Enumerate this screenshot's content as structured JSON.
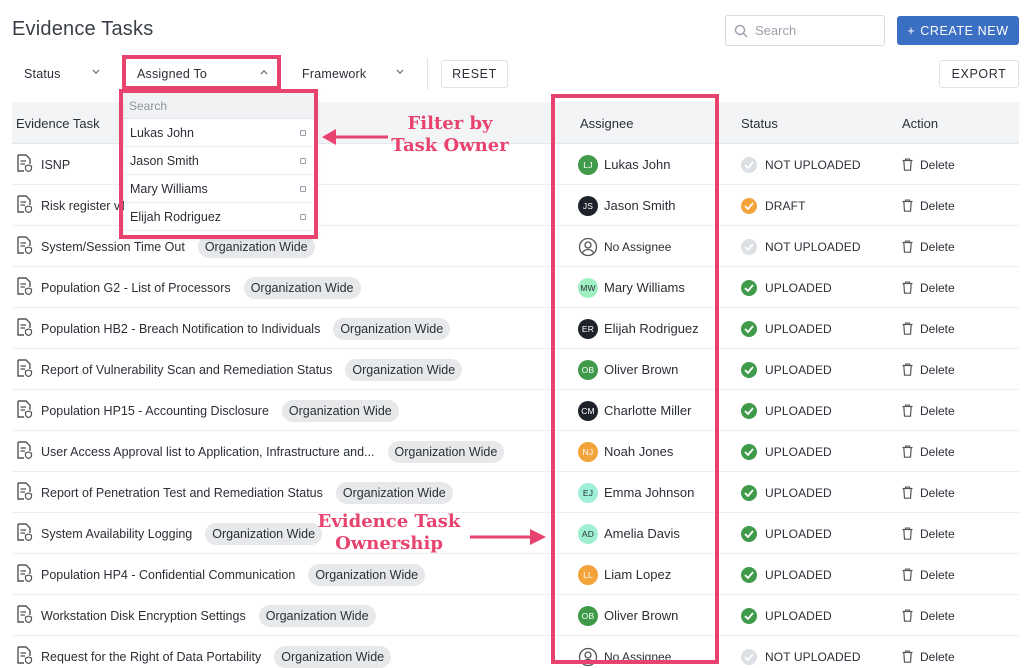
{
  "page": {
    "title": "Evidence Tasks"
  },
  "header": {
    "search_placeholder": "Search",
    "create_label": "CREATE NEW",
    "create_icon": "plus"
  },
  "filters": {
    "status_label": "Status",
    "assigned_label": "Assigned To",
    "framework_label": "Framework",
    "reset_label": "RESET",
    "export_label": "EXPORT"
  },
  "dropdown": {
    "search_placeholder": "Search",
    "options": [
      "Lukas John",
      "Jason Smith",
      "Mary Williams",
      "Elijah Rodriguez"
    ]
  },
  "table": {
    "columns": [
      "Evidence Task",
      "Assignee",
      "Status",
      "Action"
    ],
    "rows": [
      {
        "task": "ISNP",
        "tag": "",
        "initials": "LJ",
        "assignee": "Lukas John",
        "avatar_bg": "#3f9b4a",
        "avatar_fg": "#ffffff",
        "status": "NOT UPLOADED",
        "status_kind": "not",
        "action": "Delete"
      },
      {
        "task": "Risk register v1",
        "tag": "",
        "initials": "JS",
        "assignee": "Jason Smith",
        "avatar_bg": "#1e232b",
        "avatar_fg": "#ffffff",
        "status": "DRAFT",
        "status_kind": "draft",
        "action": "Delete"
      },
      {
        "task": "System/Session Time Out",
        "tag": "Organization Wide",
        "initials": "",
        "assignee": "No Assignee",
        "avatar_bg": "",
        "avatar_fg": "",
        "status": "NOT UPLOADED",
        "status_kind": "not",
        "action": "Delete"
      },
      {
        "task": "Population G2 - List of Processors",
        "tag": "Organization Wide",
        "initials": "MW",
        "assignee": "Mary Williams",
        "avatar_bg": "#9ef0c0",
        "avatar_fg": "#2b2f36",
        "status": "UPLOADED",
        "status_kind": "ok",
        "action": "Delete"
      },
      {
        "task": "Population HB2 - Breach Notification to Individuals",
        "tag": "Organization Wide",
        "initials": "ER",
        "assignee": "Elijah Rodriguez",
        "avatar_bg": "#1e232b",
        "avatar_fg": "#ffffff",
        "status": "UPLOADED",
        "status_kind": "ok",
        "action": "Delete"
      },
      {
        "task": "Report of Vulnerability Scan and Remediation Status",
        "tag": "Organization Wide",
        "initials": "OB",
        "assignee": "Oliver Brown",
        "avatar_bg": "#3f9b4a",
        "avatar_fg": "#ffffff",
        "status": "UPLOADED",
        "status_kind": "ok",
        "action": "Delete"
      },
      {
        "task": "Population HP15 - Accounting Disclosure",
        "tag": "Organization Wide",
        "initials": "CM",
        "assignee": "Charlotte Miller",
        "avatar_bg": "#1e232b",
        "avatar_fg": "#ffffff",
        "status": "UPLOADED",
        "status_kind": "ok",
        "action": "Delete"
      },
      {
        "task": "User Access Approval list to Application, Infrastructure and...",
        "tag": "Organization Wide",
        "initials": "NJ",
        "assignee": "Noah Jones",
        "avatar_bg": "#f2a33a",
        "avatar_fg": "#ffffff",
        "status": "UPLOADED",
        "status_kind": "ok",
        "action": "Delete"
      },
      {
        "task": "Report of Penetration Test and Remediation Status",
        "tag": "Organization Wide",
        "initials": "EJ",
        "assignee": "Emma Johnson",
        "avatar_bg": "#9ef0d8",
        "avatar_fg": "#2b2f36",
        "status": "UPLOADED",
        "status_kind": "ok",
        "action": "Delete"
      },
      {
        "task": "System Availability Logging",
        "tag": "Organization Wide",
        "initials": "AD",
        "assignee": "Amelia Davis",
        "avatar_bg": "#9ef0d0",
        "avatar_fg": "#2b2f36",
        "status": "UPLOADED",
        "status_kind": "ok",
        "action": "Delete"
      },
      {
        "task": "Population HP4 - Confidential Communication",
        "tag": "Organization Wide",
        "initials": "LL",
        "assignee": "Liam Lopez",
        "avatar_bg": "#f2a33a",
        "avatar_fg": "#ffffff",
        "status": "UPLOADED",
        "status_kind": "ok",
        "action": "Delete"
      },
      {
        "task": "Workstation Disk Encryption Settings",
        "tag": "Organization Wide",
        "initials": "OB",
        "assignee": "Oliver Brown",
        "avatar_bg": "#3f9b4a",
        "avatar_fg": "#ffffff",
        "status": "UPLOADED",
        "status_kind": "ok",
        "action": "Delete"
      },
      {
        "task": "Request for the Right of Data Portability",
        "tag": "Organization Wide",
        "initials": "",
        "assignee": "No Assignee",
        "avatar_bg": "",
        "avatar_fg": "",
        "status": "NOT UPLOADED",
        "status_kind": "not",
        "action": "Delete"
      }
    ]
  },
  "annotations": {
    "filter_note": "Filter by Task Owner",
    "ownership_note": "Evidence Task Ownership"
  },
  "colors": {
    "accent": "#3b6fc4",
    "highlight": "#e8436e",
    "uploaded": "#3f9b4a",
    "draft": "#f2a33a",
    "not_uploaded": "#dcdfe3"
  }
}
